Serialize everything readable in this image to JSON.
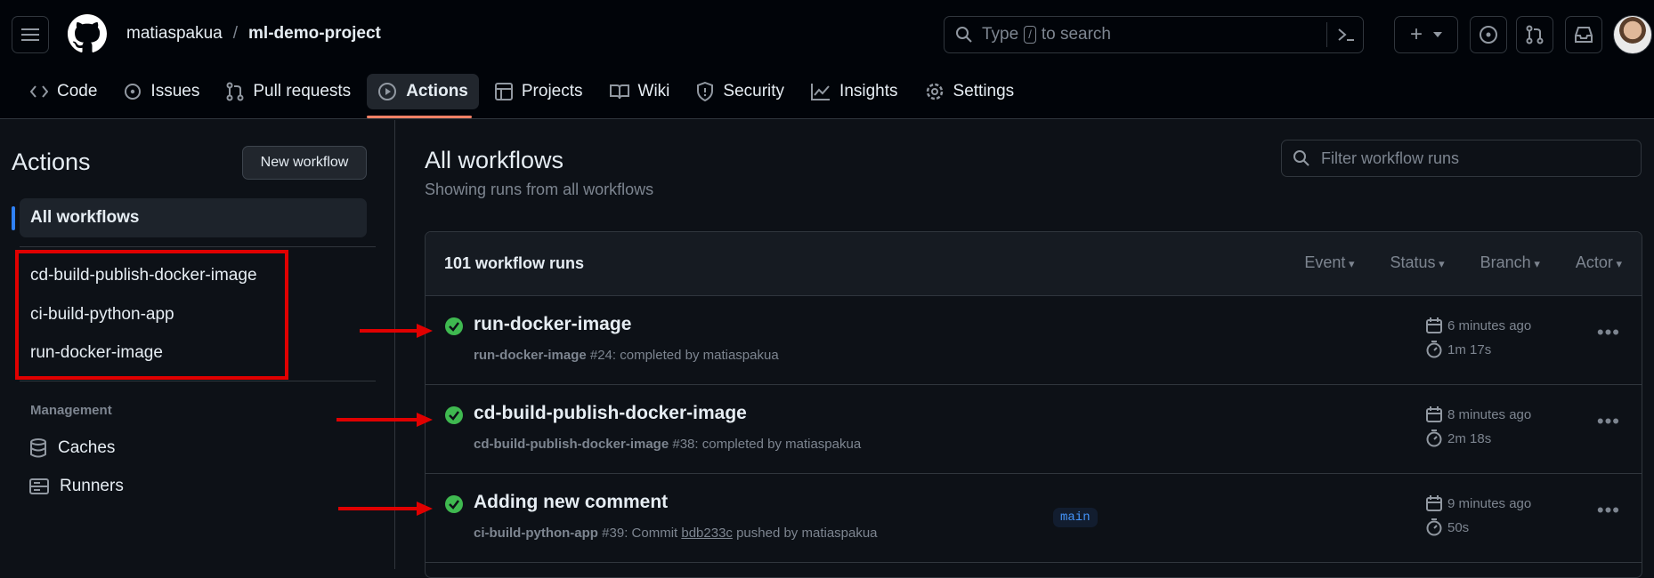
{
  "header": {
    "owner": "matiaspakua",
    "separator": "/",
    "repo": "ml-demo-project",
    "search_prefix": "Type",
    "search_key": "/",
    "search_suffix": "to search",
    "plus_label": "+"
  },
  "tabs": [
    {
      "label": "Code",
      "icon": "code-icon"
    },
    {
      "label": "Issues",
      "icon": "issue-icon"
    },
    {
      "label": "Pull requests",
      "icon": "pull-request-icon"
    },
    {
      "label": "Actions",
      "icon": "play-icon",
      "active": true
    },
    {
      "label": "Projects",
      "icon": "table-icon"
    },
    {
      "label": "Wiki",
      "icon": "book-icon"
    },
    {
      "label": "Security",
      "icon": "shield-icon"
    },
    {
      "label": "Insights",
      "icon": "graph-icon"
    },
    {
      "label": "Settings",
      "icon": "gear-icon"
    }
  ],
  "sidebar": {
    "title": "Actions",
    "new_workflow": "New workflow",
    "all_workflows": "All workflows",
    "workflows": [
      "cd-build-publish-docker-image",
      "ci-build-python-app",
      "run-docker-image"
    ],
    "management_label": "Management",
    "management_items": [
      "Caches",
      "Runners"
    ]
  },
  "main": {
    "title": "All workflows",
    "subtitle": "Showing runs from all workflows",
    "filter_placeholder": "Filter workflow runs",
    "run_count": "101 workflow runs",
    "filters": [
      "Event",
      "Status",
      "Branch",
      "Actor"
    ],
    "runs": [
      {
        "title": "run-docker-image",
        "workflow": "run-docker-image",
        "number": "#24",
        "desc": ": completed by matiaspakua",
        "time": "6 minutes ago",
        "duration": "1m 17s"
      },
      {
        "title": "cd-build-publish-docker-image",
        "workflow": "cd-build-publish-docker-image",
        "number": "#38",
        "desc": ": completed by matiaspakua",
        "time": "8 minutes ago",
        "duration": "2m 18s"
      },
      {
        "title": "Adding new comment",
        "workflow": "ci-build-python-app",
        "number": "#39",
        "desc_pre": ": Commit ",
        "sha": "bdb233c",
        "desc_post": " pushed by matiaspakua",
        "branch": "main",
        "time": "9 minutes ago",
        "duration": "50s"
      }
    ]
  },
  "colors": {
    "success": "#3fb950",
    "annotation": "#e00000",
    "accent": "#f78166"
  }
}
